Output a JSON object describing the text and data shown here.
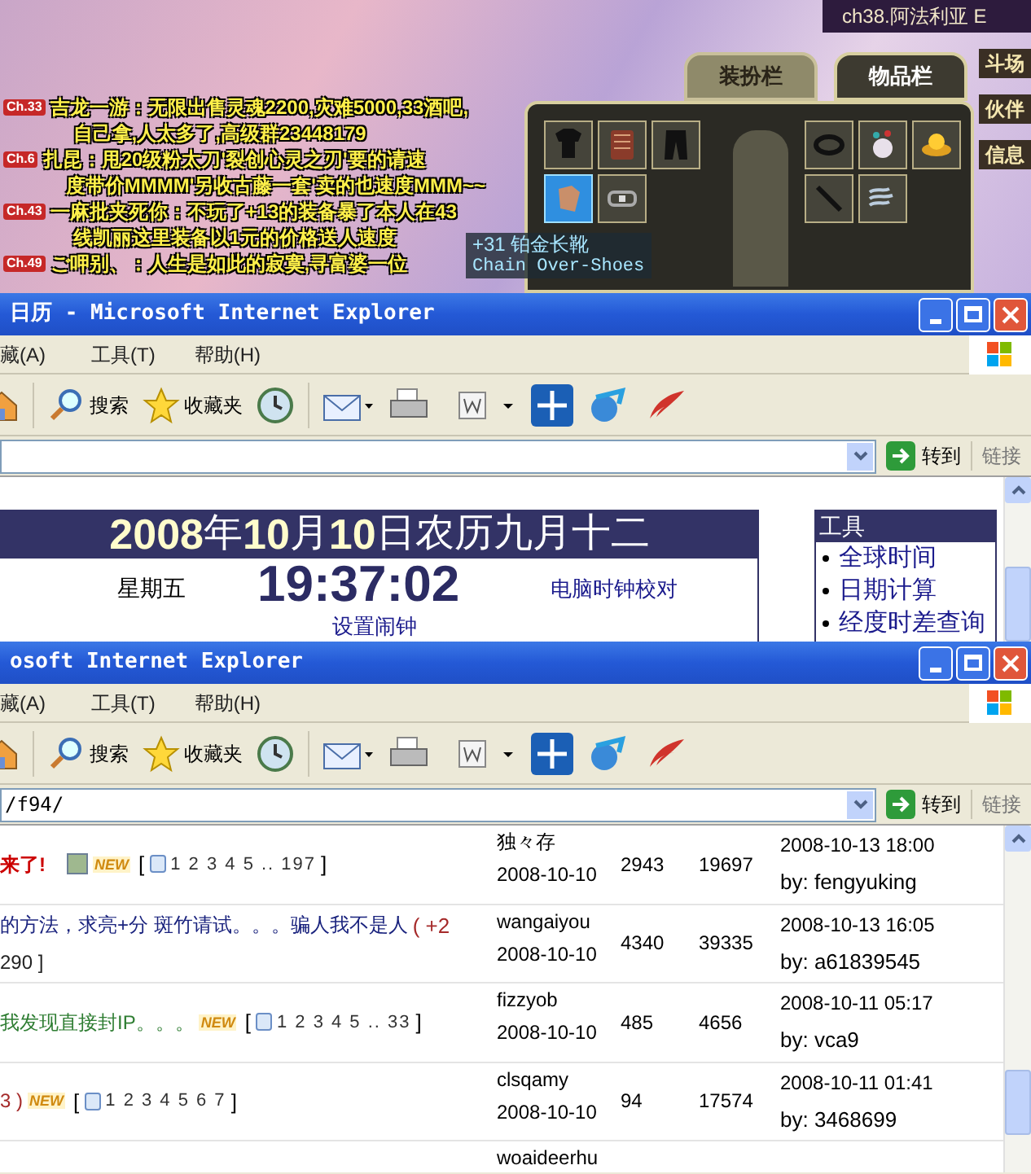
{
  "game": {
    "location": "ch38.阿法利亚 E",
    "chat": [
      {
        "channel": "Ch.33",
        "text": "吉龙一游：无限出售灵魂2200,灾难5000,33酒吧,",
        "cont": "自己拿,人太多了,高级群23448179"
      },
      {
        "channel": "Ch.6",
        "text": "扎昆：甩20级粉太刀'裂创心灵之刃'要的请速",
        "cont": "度带价MMMM'另收古藤一套'卖的也速度MMM~~"
      },
      {
        "channel": "Ch.43",
        "text": "一麻批夹死你：不玩了+13的装备暴了本人在43",
        "cont": "线凯丽这里装备以1元的价格送人速度"
      },
      {
        "channel": "Ch.49",
        "text": "ご呷别、：人生是如此的寂寞,寻富婆一位"
      }
    ],
    "tabs": [
      {
        "label": "装扮栏",
        "selected": false
      },
      {
        "label": "物品栏",
        "selected": true
      }
    ],
    "side_menu": [
      "斗场",
      "伙伴",
      "信息"
    ],
    "left_slots": [
      {
        "kind": "shirt",
        "selected": false
      },
      {
        "kind": "armor",
        "selected": false
      },
      {
        "kind": "pants",
        "selected": false
      },
      {
        "kind": "glove",
        "selected": true
      },
      {
        "kind": "belt",
        "selected": false
      }
    ],
    "right_slots": [
      {
        "kind": "bracelet",
        "selected": false
      },
      {
        "kind": "pouch",
        "selected": false
      },
      {
        "kind": "crown",
        "selected": false
      },
      {
        "kind": "sword",
        "selected": false
      },
      {
        "kind": "scroll",
        "selected": false
      }
    ],
    "tooltip": {
      "name": "+31 铂金长靴",
      "english": "Chain Over-Shoes"
    }
  },
  "windows": [
    {
      "title": "日历 - Microsoft Internet Explorer",
      "menu": [
        "藏(A)",
        "工具(T)",
        "帮助(H)"
      ],
      "search_label": "搜索",
      "favorites_label": "收藏夹",
      "go_label": "转到",
      "links_label": "链接",
      "calendar": {
        "date_parts": [
          {
            "text": "2008",
            "kind": "number"
          },
          {
            "text": "年",
            "kind": "unit"
          },
          {
            "text": "10",
            "kind": "number"
          },
          {
            "text": "月",
            "kind": "unit"
          },
          {
            "text": "10",
            "kind": "number"
          },
          {
            "text": "日农历九月十二",
            "kind": "unit"
          }
        ],
        "weekday": "星期五",
        "time": "19:37:02",
        "sync_link": "电脑时钟校对",
        "alarm_link": "设置闹钟",
        "tools_title": "工具",
        "tools": [
          "全球时间",
          "日期计算",
          "经度时差查询"
        ]
      }
    },
    {
      "title": "osoft Internet Explorer",
      "menu": [
        "藏(A)",
        "工具(T)",
        "帮助(H)"
      ],
      "search_label": "搜索",
      "favorites_label": "收藏夹",
      "address": "/f94/",
      "go_label": "转到",
      "links_label": "链接",
      "threads": [
        {
          "title": "来了!",
          "color": "#cc0000",
          "image": true,
          "badge": "NEW",
          "open": "[",
          "pages": "1 2 3 4 5 .. 197",
          "close": "]",
          "author": "独々存",
          "date": "2008-10-10",
          "replies": "2943",
          "views": "19697",
          "last": "2008-10-13 18:00",
          "by": "by: fengyuking"
        },
        {
          "title": "的方法，求亮+分 斑竹请试。。。骗人我不是人",
          "color": "#1a237e",
          "note": "( +2",
          "note2": "290 ]",
          "image": false,
          "author": "wangaiyou",
          "date": "2008-10-10",
          "replies": "4340",
          "views": "39335",
          "last": "2008-10-13 16:05",
          "by": "by: a61839545"
        },
        {
          "title": "我发现直接封IP。。。",
          "color": "#2e7d32",
          "image": false,
          "badge": "NEW",
          "open": "[",
          "pages": "1 2 3 4 5 .. 33",
          "close": "]",
          "author": "fizzyob",
          "date": "2008-10-10",
          "replies": "485",
          "views": "4656",
          "last": "2008-10-11 05:17",
          "by": "by: vca9"
        },
        {
          "title": "3 )",
          "color": "#a52a2a",
          "image": false,
          "badge": "NEW",
          "open": "[",
          "pages": "1 2 3 4 5 6 7",
          "close": "]",
          "author": "clsqamy",
          "date": "2008-10-10",
          "replies": "94",
          "views": "17574",
          "last": "2008-10-11 01:41",
          "by": "by: 3468699"
        },
        {
          "author": "woaideerhu"
        }
      ]
    }
  ]
}
